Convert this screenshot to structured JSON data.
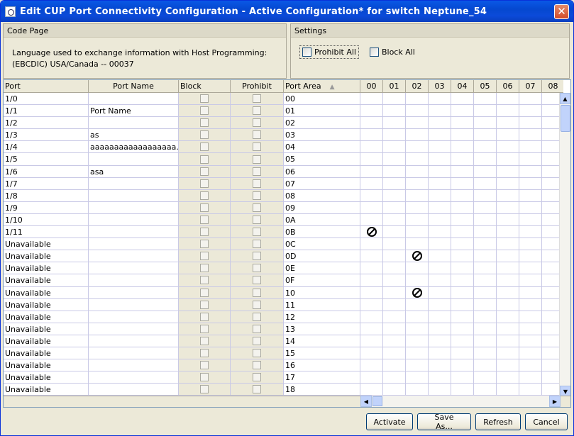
{
  "window": {
    "title": "Edit CUP Port Connectivity Configuration - Active Configuration* for switch Neptune_54",
    "close_glyph": "✕"
  },
  "code_page": {
    "header": "Code Page",
    "line1": "Language used to exchange information with Host Programming:",
    "line2": "(EBCDIC) USA/Canada -- 00037"
  },
  "settings": {
    "header": "Settings",
    "prohibit_all": "Prohibit All",
    "block_all": "Block All"
  },
  "table": {
    "headers": {
      "port": "Port",
      "port_name": "Port Name",
      "block": "Block",
      "prohibit": "Prohibit",
      "port_area": "Port Area",
      "sort_glyph": "▲"
    },
    "rows": [
      {
        "port": "1/0",
        "name": "",
        "area": "00"
      },
      {
        "port": "1/1",
        "name": "Port Name",
        "area": "01"
      },
      {
        "port": "1/2",
        "name": "",
        "area": "02"
      },
      {
        "port": "1/3",
        "name": "as",
        "area": "03"
      },
      {
        "port": "1/4",
        "name": "aaaaaaaaaaaaaaaaaa...",
        "area": "04"
      },
      {
        "port": "1/5",
        "name": "",
        "area": "05"
      },
      {
        "port": "1/6",
        "name": "asa",
        "area": "06"
      },
      {
        "port": "1/7",
        "name": "",
        "area": "07"
      },
      {
        "port": "1/8",
        "name": "",
        "area": "08"
      },
      {
        "port": "1/9",
        "name": "",
        "area": "09"
      },
      {
        "port": "1/10",
        "name": "",
        "area": "0A"
      },
      {
        "port": "1/11",
        "name": "",
        "area": "0B"
      },
      {
        "port": "Unavailable",
        "name": "",
        "area": "0C"
      },
      {
        "port": "Unavailable",
        "name": "",
        "area": "0D"
      },
      {
        "port": "Unavailable",
        "name": "",
        "area": "0E"
      },
      {
        "port": "Unavailable",
        "name": "",
        "area": "0F"
      },
      {
        "port": "Unavailable",
        "name": "",
        "area": "10"
      },
      {
        "port": "Unavailable",
        "name": "",
        "area": "11"
      },
      {
        "port": "Unavailable",
        "name": "",
        "area": "12"
      },
      {
        "port": "Unavailable",
        "name": "",
        "area": "13"
      },
      {
        "port": "Unavailable",
        "name": "",
        "area": "14"
      },
      {
        "port": "Unavailable",
        "name": "",
        "area": "15"
      },
      {
        "port": "Unavailable",
        "name": "",
        "area": "16"
      },
      {
        "port": "Unavailable",
        "name": "",
        "area": "17"
      },
      {
        "port": "Unavailable",
        "name": "",
        "area": "18"
      }
    ],
    "matrix_columns": [
      "00",
      "01",
      "02",
      "03",
      "04",
      "05",
      "06",
      "07",
      "08"
    ],
    "prohibited_cells": [
      {
        "row": 11,
        "col": 0
      },
      {
        "row": 13,
        "col": 2
      },
      {
        "row": 16,
        "col": 2
      }
    ]
  },
  "scrollbar": {
    "up": "▲",
    "down": "▼",
    "left": "◀",
    "right": "▶"
  },
  "buttons": {
    "activate": "Activate",
    "save_as": "Save As...",
    "refresh": "Refresh",
    "cancel": "Cancel"
  }
}
